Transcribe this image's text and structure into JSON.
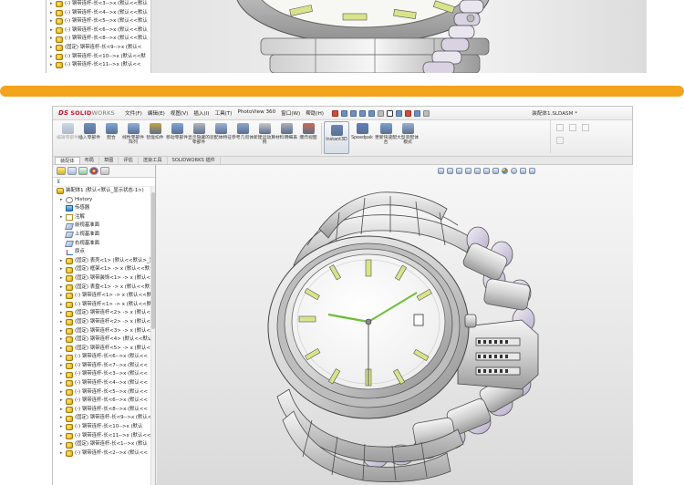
{
  "top_tree": {
    "rows": [
      {
        "label": "(-) 钢带连杆-长<3-->x (默认<<默认",
        "icon": "part-icon"
      },
      {
        "label": "(-) 钢带连杆-长<4-->x (默认<<默认",
        "icon": "part-icon"
      },
      {
        "label": "(-) 钢带连杆-长<5-->x (默认<<默认",
        "icon": "part-icon"
      },
      {
        "label": "(-) 钢带连杆-长<6-->x (默认<<默认",
        "icon": "part-icon"
      },
      {
        "label": "(-) 钢带连杆-长<8-->x (默认<<默认",
        "icon": "part-icon"
      },
      {
        "label": "(固定) 钢带连杆-长<9-->x (默认<",
        "icon": "part-icon"
      },
      {
        "label": "(-) 钢带连杆-长<10-->x (默认<<默",
        "icon": "part-icon"
      },
      {
        "label": "(-) 钢带连杆-长<11-->x (默认<<",
        "icon": "part-icon"
      }
    ]
  },
  "app": {
    "logo_prefix": "DS",
    "logo_name": "SOLID",
    "logo_suffix": "WORKS",
    "menus": [
      "文件(F)",
      "编辑(E)",
      "视图(V)",
      "插入(I)",
      "工具(T)",
      "PhotoView 360",
      "窗口(W)",
      "帮助(H)"
    ],
    "document_title": "装配体1.SLDASM *"
  },
  "commands": [
    {
      "label": "编辑零部件",
      "icon": "edit-component-icon",
      "disabled": true
    },
    {
      "label": "插入零部件",
      "icon": "insert-component-icon",
      "disabled": false
    },
    {
      "label": "配合",
      "icon": "mate-icon",
      "disabled": false
    },
    {
      "label": "线性零部件阵列",
      "icon": "linear-pattern-icon",
      "disabled": false
    },
    {
      "label": "智能扣件",
      "icon": "smart-fastener-icon",
      "disabled": false
    },
    {
      "label": "移动零部件",
      "icon": "move-component-icon",
      "disabled": false
    },
    {
      "label": "显示隐藏的零部件",
      "icon": "show-hidden-icon",
      "disabled": false
    },
    {
      "label": "装配体特征",
      "icon": "assembly-feature-icon",
      "disabled": false
    },
    {
      "label": "参考几何体",
      "icon": "reference-geometry-icon",
      "disabled": false
    },
    {
      "label": "新建运动算例",
      "icon": "motion-study-icon",
      "disabled": false
    },
    {
      "label": "材料明细表",
      "icon": "bom-icon",
      "disabled": false
    },
    {
      "label": "爆炸视图",
      "icon": "exploded-view-icon",
      "disabled": false
    },
    {
      "label": "Instant3D",
      "icon": "instant3d-icon",
      "disabled": false,
      "active": true
    },
    {
      "label": "Speedpak",
      "icon": "speedpak-icon",
      "disabled": false
    },
    {
      "label": "更新快速配合",
      "icon": "quick-mate-icon",
      "disabled": false
    },
    {
      "label": "大型装配体模式",
      "icon": "large-assembly-icon",
      "disabled": false
    }
  ],
  "tabs": [
    "装配体",
    "布局",
    "草图",
    "评估",
    "渲染工具",
    "SOLIDWORKS 插件"
  ],
  "active_tab": 0,
  "tree": {
    "root": "装配体1 (默认<默认_显示状态-1>)",
    "rows": [
      {
        "label": "History",
        "icon": "history-icon",
        "exp": "▸"
      },
      {
        "label": "传感器",
        "icon": "sensor-icon",
        "exp": ""
      },
      {
        "label": "注解",
        "icon": "annotation-icon",
        "exp": "▸"
      },
      {
        "label": "前视基准面",
        "icon": "plane-icon",
        "exp": ""
      },
      {
        "label": "上视基准面",
        "icon": "plane-icon",
        "exp": ""
      },
      {
        "label": "右视基准面",
        "icon": "plane-icon",
        "exp": ""
      },
      {
        "label": "原点",
        "icon": "origin-icon",
        "exp": ""
      },
      {
        "label": "(固定) 表壳<1> (默认<<默认>_显",
        "icon": "part-icon",
        "exp": "▸"
      },
      {
        "label": "(固定) 框架<1> -> x (默认<<默认",
        "icon": "part-icon",
        "exp": "▸"
      },
      {
        "label": "(固定) 钢带装饰<1> -> x (默认<<",
        "icon": "part-icon",
        "exp": "▸"
      },
      {
        "label": "(固定) 表盘<1> -> x (默认<<默认",
        "icon": "part-icon",
        "exp": "▸"
      },
      {
        "label": "(-) 钢带连杆<1> -> x (默认<<默",
        "icon": "part-icon",
        "exp": "▸"
      },
      {
        "label": "(-) 钢带连杆<1> -> x (默认<<默",
        "icon": "part-icon",
        "exp": "▸"
      },
      {
        "label": "(固定) 钢带连杆<2> -> x (默认<<",
        "icon": "part-icon",
        "exp": "▸"
      },
      {
        "label": "(固定) 钢带连杆<2> -> x (默认<<_显",
        "icon": "part-icon",
        "exp": "▸"
      },
      {
        "label": "(固定) 钢带连杆<3> -> x (默认<<",
        "icon": "part-icon",
        "exp": "▸"
      },
      {
        "label": "(固定) 钢带连杆<4> (默认<<默认",
        "icon": "part-icon",
        "exp": "▸"
      },
      {
        "label": "(固定) 钢带连杆<5> -> x (默认<",
        "icon": "part-icon",
        "exp": "▸"
      },
      {
        "label": "(-) 钢带连杆-长<6-->x (默认<<",
        "icon": "part-icon",
        "exp": "▸"
      },
      {
        "label": "(-) 钢带连杆-长<7-->x (默认<<",
        "icon": "part-icon",
        "exp": "▸"
      },
      {
        "label": "(-) 钢带连杆-长<3-->x (默认<<",
        "icon": "part-icon",
        "exp": "▸"
      },
      {
        "label": "(-) 钢带连杆-长<4-->x (默认<<",
        "icon": "part-icon",
        "exp": "▸"
      },
      {
        "label": "(-) 钢带连杆-长<5-->x (默认<<",
        "icon": "part-icon",
        "exp": "▸"
      },
      {
        "label": "(-) 钢带连杆-长<6-->x (默认<<",
        "icon": "part-icon",
        "exp": "▸"
      },
      {
        "label": "(-) 钢带连杆-长<8-->x (默认<<",
        "icon": "part-icon",
        "exp": "▸"
      },
      {
        "label": "(固定) 钢带连杆-长<9-->x (默认<",
        "icon": "part-icon",
        "exp": "▸"
      },
      {
        "label": "(-) 钢带连杆-长<10-->x (默认",
        "icon": "part-icon",
        "exp": "▸"
      },
      {
        "label": "(-) 钢带连杆-长<11-->x (默认<<",
        "icon": "part-icon",
        "exp": "▸"
      },
      {
        "label": "(固定) 钢带连杆-长<1-->x (默认",
        "icon": "part-icon",
        "exp": "▸"
      },
      {
        "label": "(-) 钢带连杆-长<2-->x (默认<<",
        "icon": "part-icon",
        "exp": "▸"
      }
    ]
  },
  "colors": {
    "accent_orange": "#f4a31c",
    "brand_red": "#c8102e",
    "lume": "#d9e48a",
    "hand_green": "#6fbf3a"
  }
}
